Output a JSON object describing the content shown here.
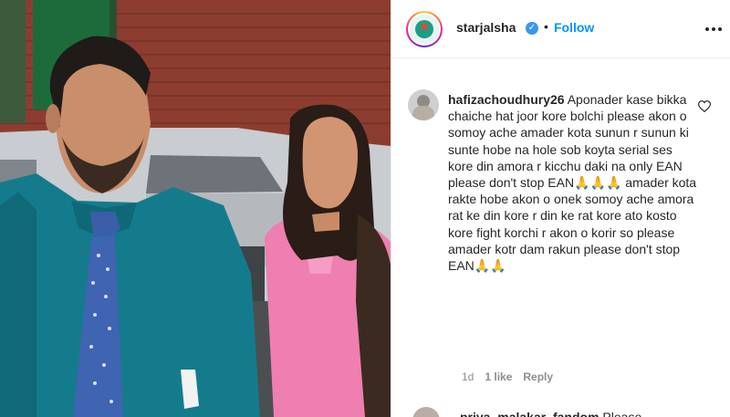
{
  "post": {
    "username": "starjalsha",
    "separator": "•",
    "follow_label": "Follow",
    "verified_glyph": "✓",
    "avatar_icon": "star-jalsha-logo-icon",
    "more_icon": "more-options-icon"
  },
  "comment": {
    "username": "hafizachoudhury26",
    "text": "Aponader kase bikka chaiche hat joor kore bolchi please akon o somoy ache amader kota sunun r sunun ki sunte hobe na hole sob koyta serial ses kore din amora r kicchu daki na only EAN please don't stop EAN🙏🙏🙏 amader kota rakte hobe akon o onek somoy ache amora rat ke din kore r din ke rat kore ato kosto kore fight korchi r akon o korir so please amader kotr dam rakun please don't stop EAN🙏🙏",
    "age": "1d",
    "likes": "1 like",
    "reply_label": "Reply",
    "like_icon": "heart-outline-icon"
  },
  "next_comment": {
    "username": "priya_malakar_fandom",
    "text_start": "Please"
  },
  "colors": {
    "link_blue": "#0095f6",
    "verified_blue": "#3897f0",
    "muted_text": "#8e8e8e",
    "primary_text": "#262626"
  }
}
